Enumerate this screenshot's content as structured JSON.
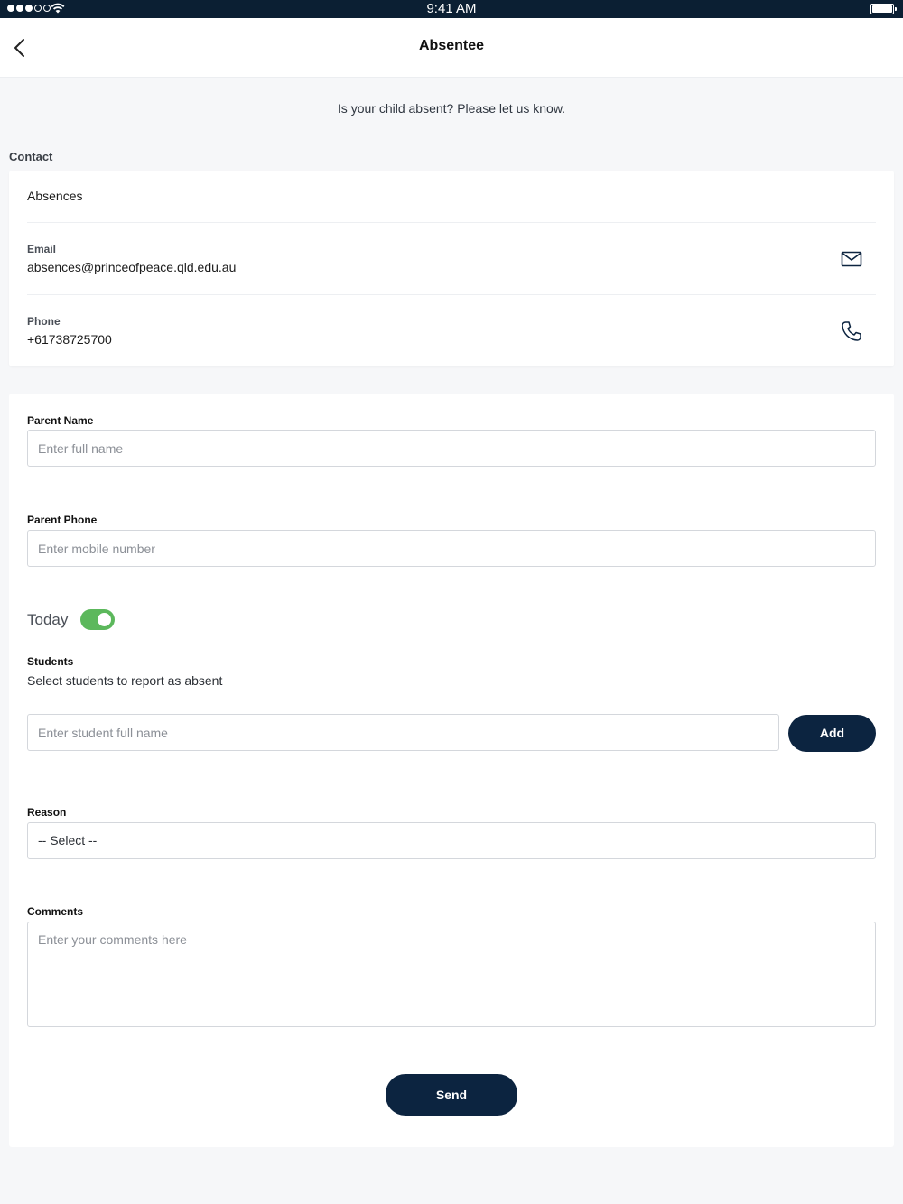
{
  "status_bar": {
    "time": "9:41 AM",
    "signal_bars_filled": 3,
    "signal_bars_total": 5
  },
  "nav": {
    "title": "Absentee",
    "back_icon": "chevron-left-icon"
  },
  "intro_text": "Is your child absent? Please let us know.",
  "contact": {
    "section_label": "Contact",
    "heading": "Absences",
    "email_label": "Email",
    "email_value": "absences@princeofpeace.qld.edu.au",
    "email_icon": "mail-icon",
    "phone_label": "Phone",
    "phone_value": "+61738725700",
    "phone_icon": "phone-icon"
  },
  "form": {
    "parent_name_label": "Parent Name",
    "parent_name_placeholder": "Enter full name",
    "parent_name_value": "",
    "parent_phone_label": "Parent Phone",
    "parent_phone_placeholder": "Enter mobile number",
    "parent_phone_value": "",
    "today_label": "Today",
    "today_on": true,
    "students_label": "Students",
    "students_help": "Select students to report as absent",
    "student_placeholder": "Enter student full name",
    "add_label": "Add",
    "reason_label": "Reason",
    "reason_selected": "-- Select --",
    "comments_label": "Comments",
    "comments_placeholder": "Enter your comments here",
    "send_label": "Send"
  },
  "colors": {
    "primary": "#0c2440",
    "toggle_on": "#5cb85c",
    "status_bar": "#0b1f33",
    "page_background": "#f6f7f9"
  }
}
